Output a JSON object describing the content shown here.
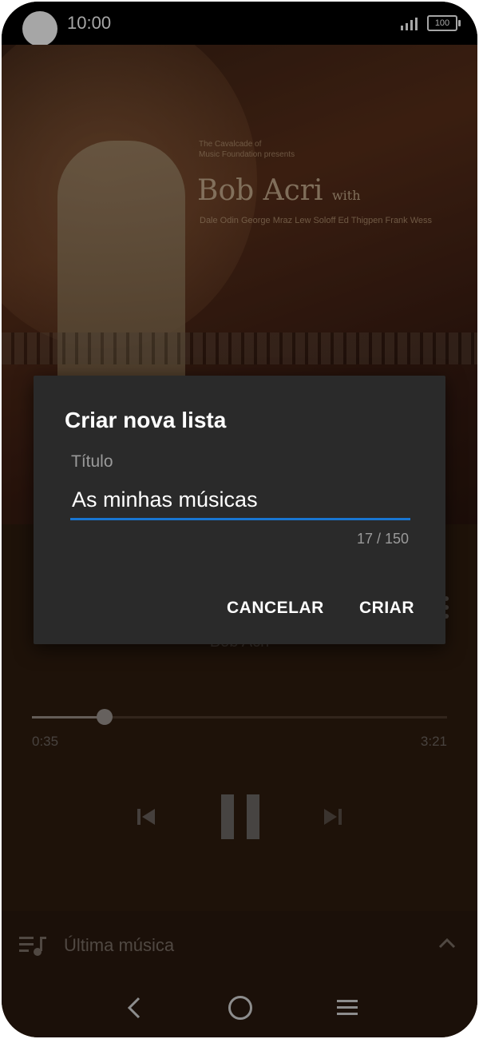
{
  "status_bar": {
    "time": "10:00",
    "battery": "100"
  },
  "album_cover": {
    "presenter_line1": "The Cavalcade of",
    "presenter_line2": "Music Foundation presents",
    "title": "Bob Acri",
    "title_suffix": "with",
    "names": "Dale Odin George Mraz Lew Soloff Ed Thigpen Frank Wess"
  },
  "player": {
    "artist": "Bob Acri",
    "elapsed": "0:35",
    "total": "3:21",
    "progress_fraction": 0.175
  },
  "dialog": {
    "title": "Criar nova lista",
    "field_label": "Título",
    "field_value": "As minhas músicas",
    "counter": "17 / 150",
    "cancel_label": "CANCELAR",
    "create_label": "CRIAR"
  },
  "bottom_panel": {
    "label": "Última música"
  },
  "colors": {
    "accent": "#1976d2",
    "dialog_bg": "#2a2a2a",
    "background": "#2e1c0f"
  },
  "icons": [
    "signal-icon",
    "previous-icon",
    "pause-icon",
    "next-icon",
    "queue-icon",
    "chevron-up-icon",
    "back-icon",
    "home-icon",
    "recent-apps-icon",
    "more-options-icon"
  ]
}
